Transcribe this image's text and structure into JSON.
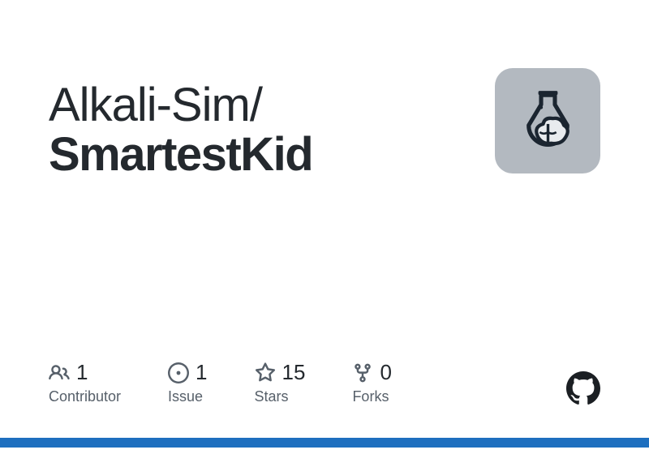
{
  "repo": {
    "owner": "Alkali-Sim",
    "name": "SmartestKid"
  },
  "stats": {
    "contributors": {
      "count": "1",
      "label": "Contributor"
    },
    "issues": {
      "count": "1",
      "label": "Issue"
    },
    "stars": {
      "count": "15",
      "label": "Stars"
    },
    "forks": {
      "count": "0",
      "label": "Forks"
    }
  },
  "accent_color": "#1e6fbf"
}
